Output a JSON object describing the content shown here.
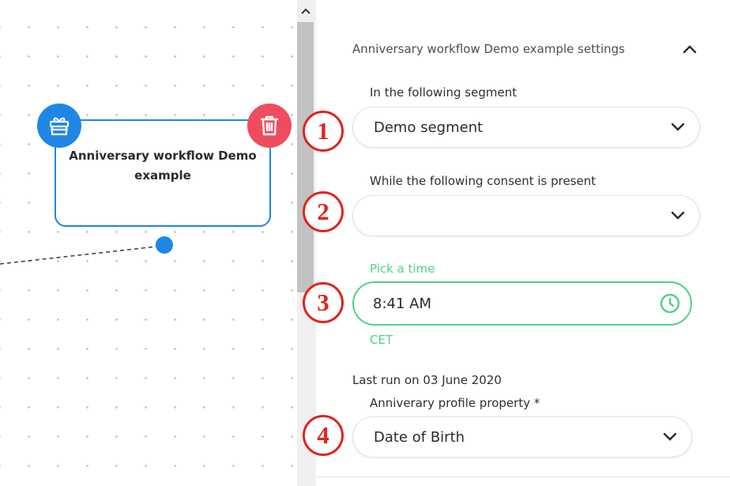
{
  "canvas": {
    "node": {
      "title": "Anniversary workflow Demo example",
      "badge_icon": "gift-icon",
      "delete_icon": "trash-icon"
    }
  },
  "panel": {
    "title": "Anniversary workflow Demo example settings",
    "segment": {
      "label": "In the following segment",
      "value": "Demo segment"
    },
    "consent": {
      "label": "While the following consent is present",
      "value": ""
    },
    "time": {
      "label": "Pick a time",
      "value": "8:41 AM",
      "timezone": "CET"
    },
    "last_run": "Last run on 03 June 2020",
    "profile_property": {
      "label": "Anniverary profile property *",
      "value": "Date of Birth"
    }
  },
  "markers": [
    "1",
    "2",
    "3",
    "4"
  ],
  "colors": {
    "primary": "#1f86e6",
    "danger": "#ef4d5f",
    "success": "#4fd18b",
    "marker": "#e0231c"
  }
}
